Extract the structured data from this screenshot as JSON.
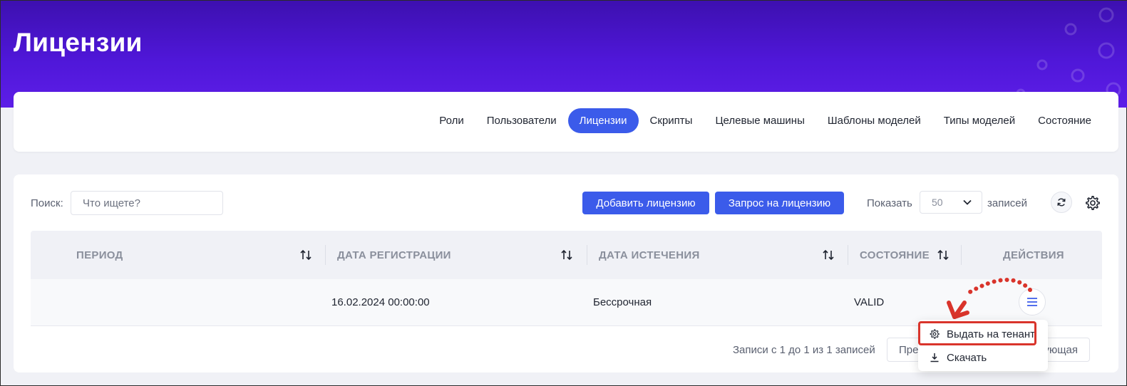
{
  "page": {
    "title": "Лицензии"
  },
  "tabs": [
    {
      "label": "Роли",
      "active": false
    },
    {
      "label": "Пользователи",
      "active": false
    },
    {
      "label": "Лицензии",
      "active": true
    },
    {
      "label": "Скрипты",
      "active": false
    },
    {
      "label": "Целевые машины",
      "active": false
    },
    {
      "label": "Шаблоны моделей",
      "active": false
    },
    {
      "label": "Типы моделей",
      "active": false
    },
    {
      "label": "Состояние",
      "active": false
    }
  ],
  "toolbar": {
    "search_label": "Поиск:",
    "search_placeholder": "Что ищете?",
    "add_license_label": "Добавить лицензию",
    "request_license_label": "Запрос на лицензию",
    "show_label": "Показать",
    "page_size": "50",
    "records_label": "записей",
    "refresh_icon": "refresh-icon",
    "settings_icon": "gear-icon"
  },
  "table": {
    "columns": [
      "ПЕРИОД",
      "ДАТА РЕГИСТРАЦИИ",
      "ДАТА ИСТЕЧЕНИЯ",
      "СОСТОЯНИЕ",
      "ДЕЙСТВИЯ"
    ],
    "rows": [
      {
        "period": "",
        "registration_date": "16.02.2024 00:00:00",
        "expiration_date": "Бессрочная",
        "status": "VALID"
      }
    ]
  },
  "footer": {
    "info": "Записи с 1 до 1 из 1 записей",
    "prev_label": "Пре",
    "next_label": "дующая"
  },
  "actions_menu": {
    "items": [
      {
        "label": "Выдать на тенант",
        "icon": "gear-icon",
        "highlighted": true
      },
      {
        "label": "Скачать",
        "icon": "download-icon",
        "highlighted": false
      }
    ]
  },
  "colors": {
    "hero_gradient_top": "#3d10b0",
    "hero_gradient_bottom": "#5d1ee8",
    "accent": "#3b5bea",
    "highlight": "#d9342b"
  }
}
